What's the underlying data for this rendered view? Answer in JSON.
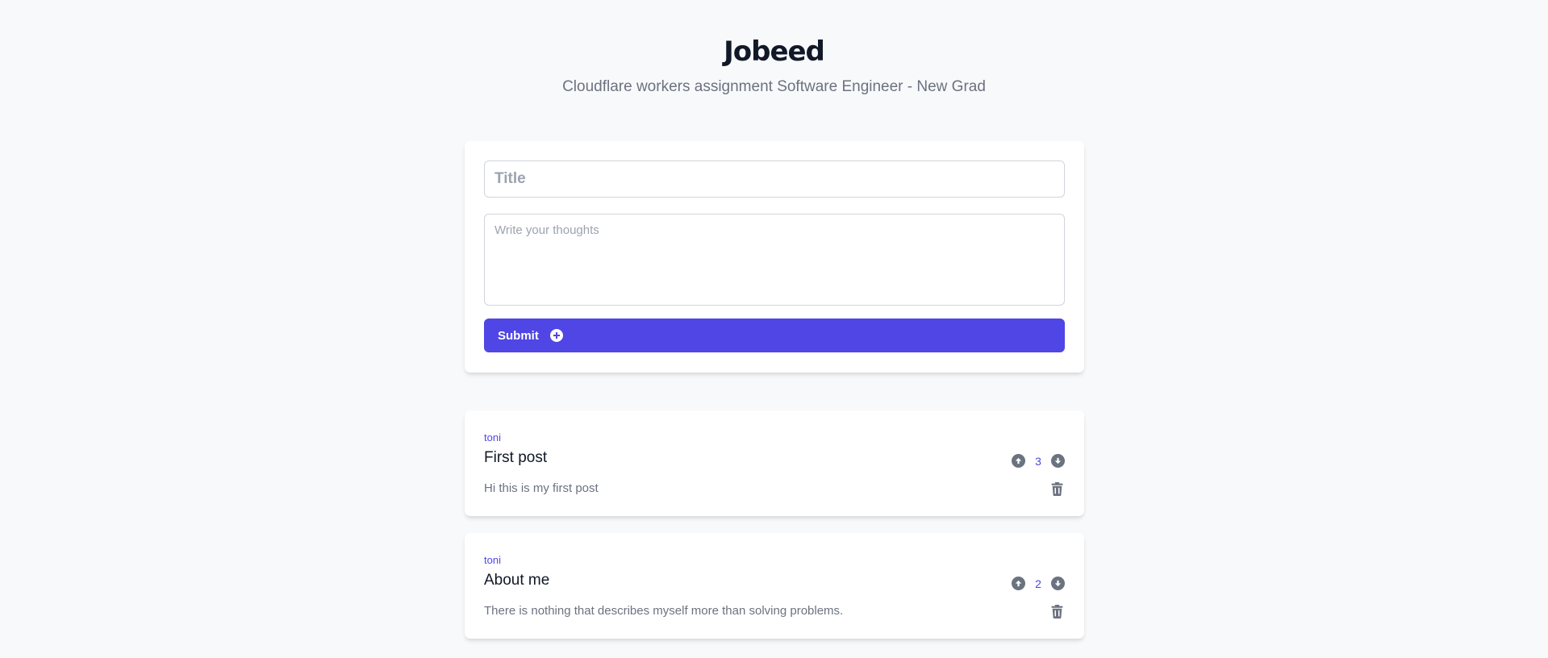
{
  "header": {
    "title": "Jobeed",
    "subtitle": "Cloudflare workers assignment Software Engineer - New Grad"
  },
  "compose": {
    "title_placeholder": "Title",
    "body_placeholder": "Write your thoughts",
    "submit_label": "Submit"
  },
  "posts": [
    {
      "author": "toni",
      "title": "First post",
      "body": "Hi this is my first post",
      "votes": "3"
    },
    {
      "author": "toni",
      "title": "About me",
      "body": "There is nothing that describes myself more than solving problems.",
      "votes": "2"
    }
  ],
  "colors": {
    "accent": "#4f46e5",
    "background": "#f8f9fb",
    "muted_text": "#6b7280",
    "icon_gray": "#6b7280"
  },
  "icons": {
    "submit": "plus-circle-icon",
    "upvote": "arrow-up-circle-icon",
    "downvote": "arrow-down-circle-icon",
    "delete": "trash-icon"
  }
}
